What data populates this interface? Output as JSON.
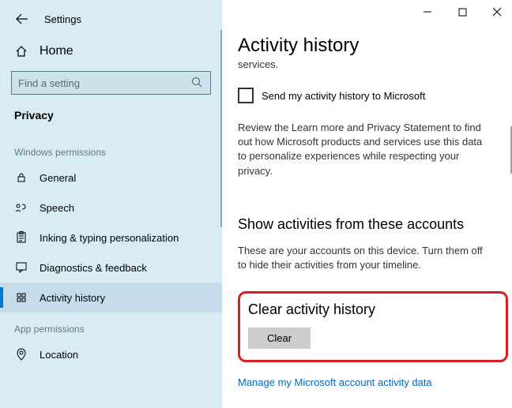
{
  "sidebar": {
    "title": "Settings",
    "home_label": "Home",
    "search_placeholder": "Find a setting",
    "current_section": "Privacy",
    "groups": [
      {
        "label": "Windows permissions",
        "items": [
          {
            "label": "General"
          },
          {
            "label": "Speech"
          },
          {
            "label": "Inking & typing personalization"
          },
          {
            "label": "Diagnostics & feedback"
          },
          {
            "label": "Activity history",
            "active": true
          }
        ]
      },
      {
        "label": "App permissions",
        "items": [
          {
            "label": "Location"
          }
        ]
      }
    ]
  },
  "main": {
    "page_title": "Activity history",
    "truncated_prev": "services.",
    "checkbox_label": "Send my activity history to Microsoft",
    "review_text": "Review the Learn more and Privacy Statement to find out how Microsoft products and services use this data to personalize experiences while respecting your privacy.",
    "accounts_heading": "Show activities from these accounts",
    "accounts_text": "These are your accounts on this device. Turn them off to hide their activities from your timeline.",
    "clear_heading": "Clear activity history",
    "clear_button": "Clear",
    "manage_link": "Manage my Microsoft account activity data"
  }
}
